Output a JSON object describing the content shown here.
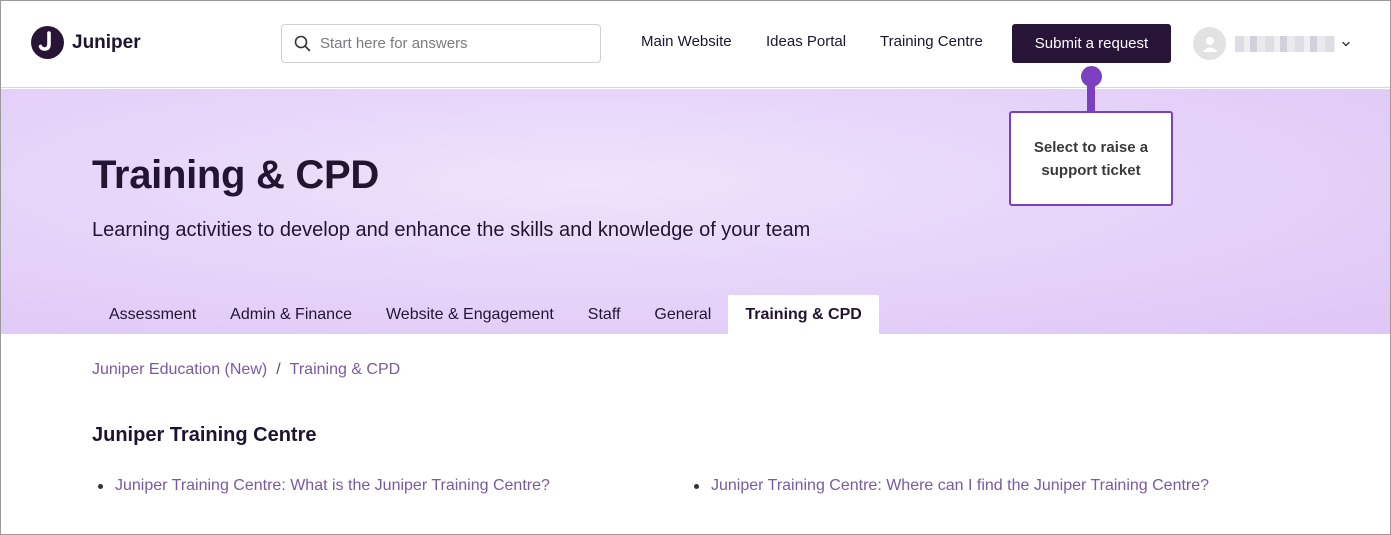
{
  "brand": {
    "name": "Juniper"
  },
  "search": {
    "placeholder": "Start here for answers"
  },
  "nav": {
    "main_website": "Main Website",
    "ideas_portal": "Ideas Portal",
    "training_centre": "Training Centre",
    "submit_request": "Submit a request"
  },
  "callout": {
    "text": "Select to raise a support ticket"
  },
  "hero": {
    "title": "Training & CPD",
    "subtitle": "Learning activities to develop and enhance the skills and knowledge of your team"
  },
  "tabs": [
    {
      "label": "Assessment"
    },
    {
      "label": "Admin & Finance"
    },
    {
      "label": "Website & Engagement"
    },
    {
      "label": "Staff"
    },
    {
      "label": "General"
    },
    {
      "label": "Training & CPD",
      "active": true
    }
  ],
  "breadcrumb": {
    "items": [
      {
        "label": "Juniper Education (New)"
      },
      {
        "label": "Training & CPD"
      }
    ],
    "separator": "/"
  },
  "section": {
    "title": "Juniper Training Centre",
    "articles": [
      {
        "label": "Juniper Training Centre: What is the Juniper Training Centre?"
      },
      {
        "label": "Juniper Training Centre: Where can I find the Juniper Training Centre?"
      }
    ]
  },
  "colors": {
    "brand_dark": "#271437",
    "accent_purple": "#7b3fbf",
    "hero_bg": "#e8d7fa",
    "link": "#7a5a9e"
  },
  "icons": {
    "logo": "juniper-logo-icon",
    "search": "search-icon",
    "avatar": "user-avatar-icon",
    "chevron": "chevron-down-icon"
  }
}
